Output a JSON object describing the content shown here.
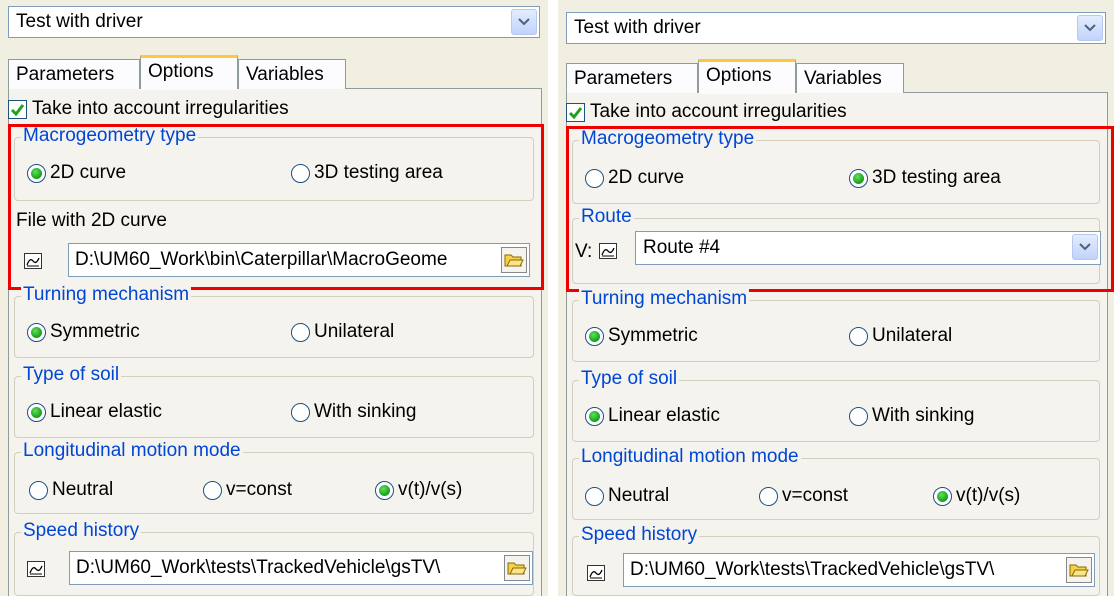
{
  "left": {
    "dropdown_value": "Test with driver",
    "tabs": [
      "Parameters",
      "Options",
      "Variables"
    ],
    "active_tab": "Options",
    "irregularities_label": "Take into account irregularities",
    "irregularities_checked": true,
    "macro": {
      "title": "Macrogeometry type",
      "opt1": "2D curve",
      "opt2": "3D testing area",
      "selected": "2D curve",
      "file_label": "File with 2D curve",
      "file_path": "D:\\UM60_Work\\bin\\Caterpillar\\MacroGeome"
    },
    "turning": {
      "title": "Turning mechanism",
      "opt1": "Symmetric",
      "opt2": "Unilateral",
      "selected": "Symmetric"
    },
    "soil": {
      "title": "Type of soil",
      "opt1": "Linear elastic",
      "opt2": "With sinking",
      "selected": "Linear elastic"
    },
    "motion": {
      "title": "Longitudinal motion mode",
      "opt1": "Neutral",
      "opt2": "v=const",
      "opt3": "v(t)/v(s)",
      "selected": "v(t)/v(s)"
    },
    "speed": {
      "title": "Speed history",
      "path": "D:\\UM60_Work\\tests\\TrackedVehicle\\gsTV\\"
    }
  },
  "right": {
    "dropdown_value": "Test with driver",
    "tabs": [
      "Parameters",
      "Options",
      "Variables"
    ],
    "active_tab": "Options",
    "irregularities_label": "Take into account irregularities",
    "irregularities_checked": true,
    "macro": {
      "title": "Macrogeometry type",
      "opt1": "2D curve",
      "opt2": "3D testing area",
      "selected": "3D testing area"
    },
    "route": {
      "title": "Route",
      "prefix": "V:",
      "value": "Route #4"
    },
    "turning": {
      "title": "Turning mechanism",
      "opt1": "Symmetric",
      "opt2": "Unilateral",
      "selected": "Symmetric"
    },
    "soil": {
      "title": "Type of soil",
      "opt1": "Linear elastic",
      "opt2": "With sinking",
      "selected": "Linear elastic"
    },
    "motion": {
      "title": "Longitudinal motion mode",
      "opt1": "Neutral",
      "opt2": "v=const",
      "opt3": "v(t)/v(s)",
      "selected": "v(t)/v(s)"
    },
    "speed": {
      "title": "Speed history",
      "path": "D:\\UM60_Work\\tests\\TrackedVehicle\\gsTV\\"
    }
  },
  "colors": {
    "highlight": "#ee0000",
    "group_title": "#0046d5",
    "tab_accent": "#ffc83c",
    "radio_selected": "#1ea81e"
  }
}
